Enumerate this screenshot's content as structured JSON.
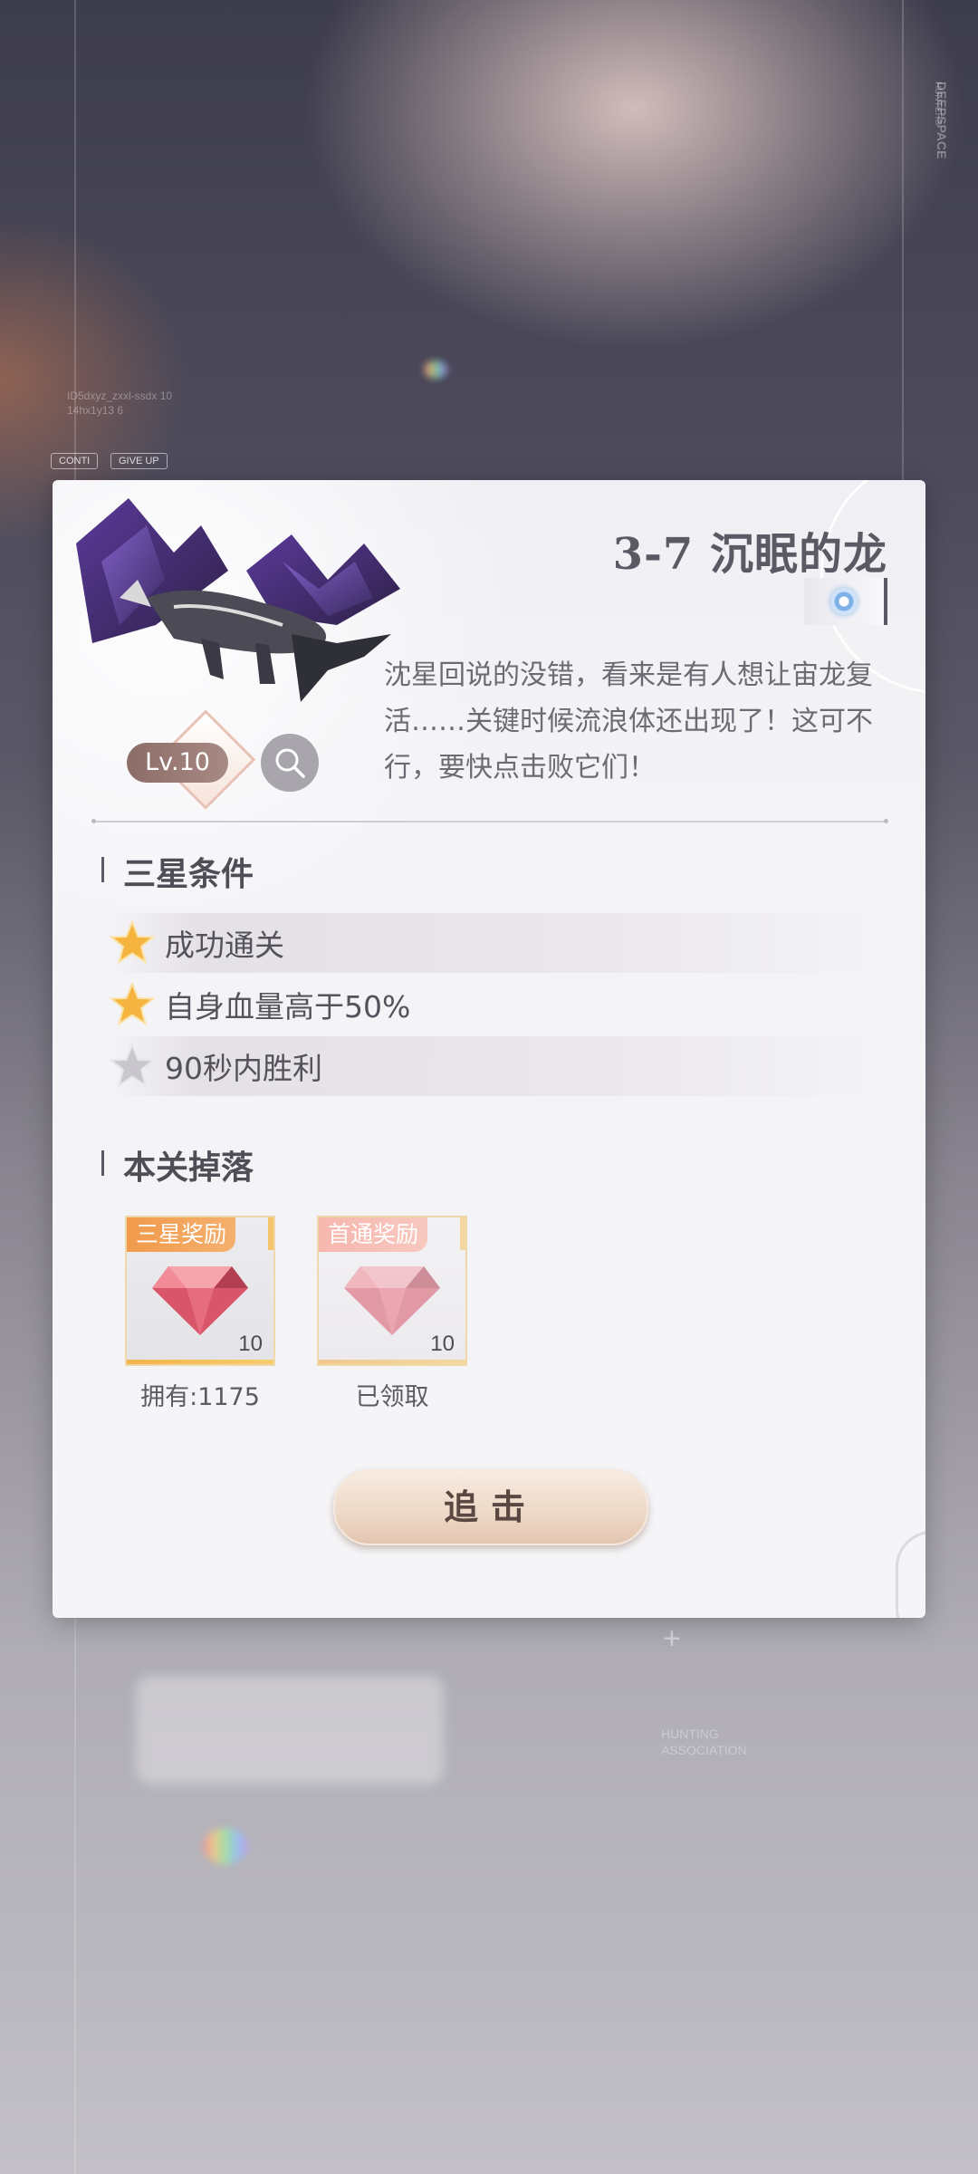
{
  "background": {
    "brand_vertical": "DEEPSPACE",
    "brand_sub": "HUNTERS",
    "small_code_1": "ID5dxyz_zxxl-ssdx 10",
    "small_code_2": "14hx1y13 6",
    "chip_continue": "CONTI",
    "chip_give_up": "GIVE UP",
    "assoc_line_1": "HUNTING",
    "assoc_line_2": "ASSOCIATION"
  },
  "stage": {
    "title": "3-7 沉眠的龙",
    "description": "沈星回说的没错，看来是有人想让宙龙复活……关键时候流浪体还出现了！这可不行，要快点击败它们！",
    "level": "Lv.10"
  },
  "conditions": {
    "title": "三星条件",
    "items": [
      {
        "text": "成功通关",
        "achieved": true
      },
      {
        "text": "自身血量高于50%",
        "achieved": true
      },
      {
        "text": "90秒内胜利",
        "achieved": false
      }
    ]
  },
  "drops": {
    "title": "本关掉落",
    "items": [
      {
        "tag": "三星奖励",
        "count": "10",
        "caption": "拥有:1175"
      },
      {
        "tag": "首通奖励",
        "count": "10",
        "caption": "已领取"
      }
    ]
  },
  "action": {
    "chase_label": "追击"
  },
  "colors": {
    "star_gold": "#f4b43f",
    "star_gray": "#c9c7cd",
    "tag_orange": "#f19a4c",
    "tag_pink": "#f6b7ae"
  }
}
